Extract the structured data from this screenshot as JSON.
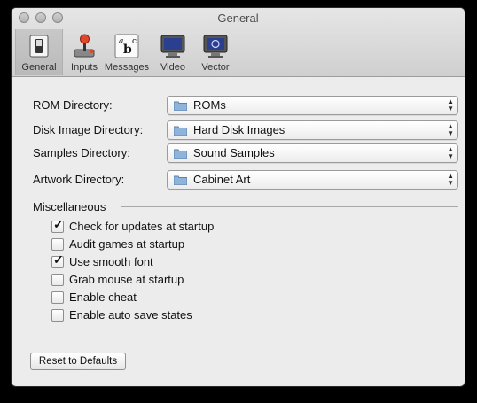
{
  "window": {
    "title": "General"
  },
  "toolbar": {
    "items": [
      {
        "label": "General",
        "icon": "switch-icon"
      },
      {
        "label": "Inputs",
        "icon": "joystick-icon"
      },
      {
        "label": "Messages",
        "icon": "abc-icon"
      },
      {
        "label": "Video",
        "icon": "monitor-icon"
      },
      {
        "label": "Vector",
        "icon": "vector-monitor-icon"
      }
    ]
  },
  "directories": [
    {
      "label": "ROM Directory:",
      "value": "ROMs"
    },
    {
      "label": "Disk Image Directory:",
      "value": "Hard Disk Images"
    },
    {
      "label": "Samples Directory:",
      "value": "Sound Samples"
    },
    {
      "label": "Artwork Directory:",
      "value": "Cabinet Art"
    }
  ],
  "misc": {
    "heading": "Miscellaneous",
    "options": [
      {
        "label": "Check for updates at startup",
        "checked": true
      },
      {
        "label": "Audit games at startup",
        "checked": false
      },
      {
        "label": "Use smooth font",
        "checked": true
      },
      {
        "label": "Grab mouse at startup",
        "checked": false
      },
      {
        "label": "Enable cheat",
        "checked": false
      },
      {
        "label": "Enable auto save states",
        "checked": false
      }
    ]
  },
  "buttons": {
    "reset": "Reset to Defaults"
  },
  "glyphs": {
    "check": "✓",
    "up_arrow": "▲",
    "down_arrow": "▼"
  }
}
